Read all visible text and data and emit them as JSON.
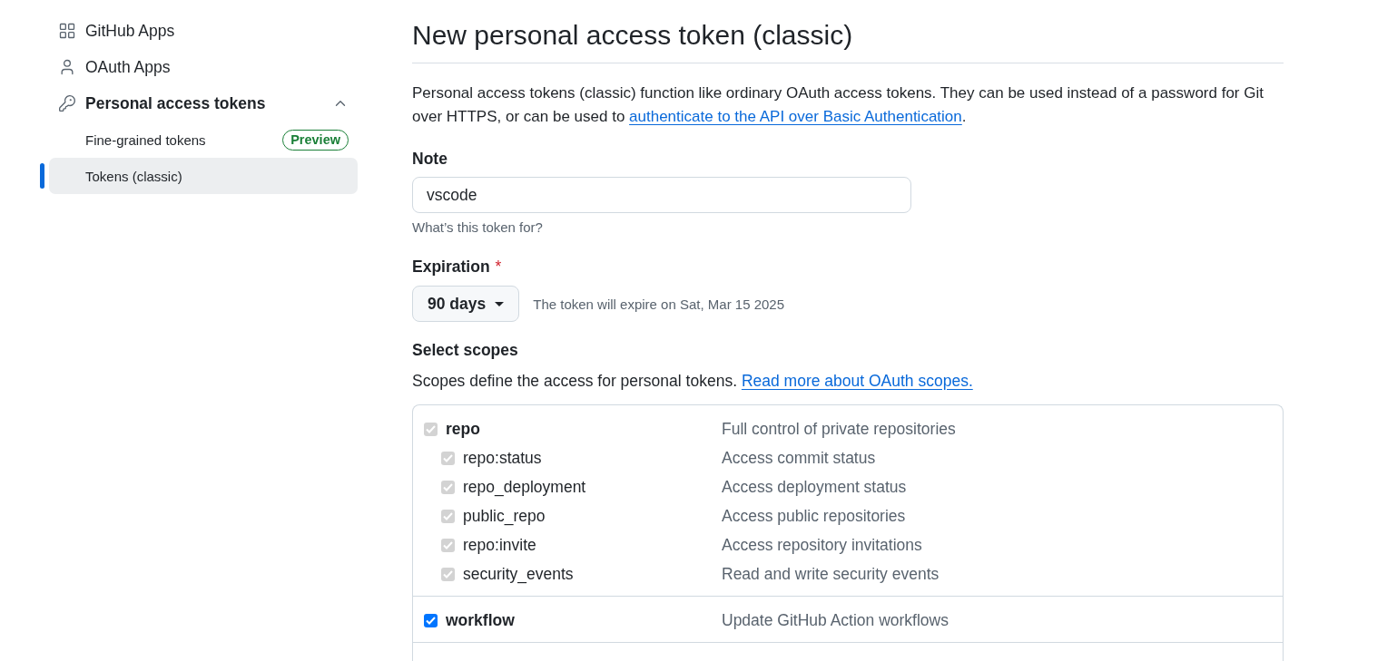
{
  "sidebar": {
    "items": [
      {
        "label": "GitHub Apps",
        "selected": false
      },
      {
        "label": "OAuth Apps",
        "selected": false
      },
      {
        "label": "Personal access tokens",
        "selected": false,
        "expanded": true,
        "children": [
          {
            "label": "Fine-grained tokens",
            "selected": false,
            "badge": "Preview"
          },
          {
            "label": "Tokens (classic)",
            "selected": true
          }
        ]
      }
    ]
  },
  "page": {
    "title": "New personal access token (classic)",
    "intro": {
      "text": "Personal access tokens (classic) function like ordinary OAuth access tokens. They can be used instead of a password for Git over HTTPS, or can be used to",
      "link": "authenticate to the API over Basic Authentication",
      "end": "."
    }
  },
  "note": {
    "label": "Note",
    "value": "vscode",
    "hint": "What’s this token for?"
  },
  "expiration": {
    "label": "Expiration",
    "required_mark": "*",
    "value": "90 days",
    "message": "The token will expire on Sat, Mar 15 2025"
  },
  "scopes": {
    "label": "Select scopes",
    "description": "Scopes define the access for personal tokens.",
    "link": "Read more about OAuth scopes.",
    "groups": [
      {
        "name": "repo",
        "description": "Full control of private repositories",
        "checked": true,
        "disabled": true,
        "children": [
          {
            "name": "repo:status",
            "description": "Access commit status",
            "checked": true,
            "disabled": true
          },
          {
            "name": "repo_deployment",
            "description": "Access deployment status",
            "checked": true,
            "disabled": true
          },
          {
            "name": "public_repo",
            "description": "Access public repositories",
            "checked": true,
            "disabled": true
          },
          {
            "name": "repo:invite",
            "description": "Access repository invitations",
            "checked": true,
            "disabled": true
          },
          {
            "name": "security_events",
            "description": "Read and write security events",
            "checked": true,
            "disabled": true
          }
        ]
      },
      {
        "name": "workflow",
        "description": "Update GitHub Action workflows",
        "checked": true,
        "disabled": false
      }
    ]
  }
}
